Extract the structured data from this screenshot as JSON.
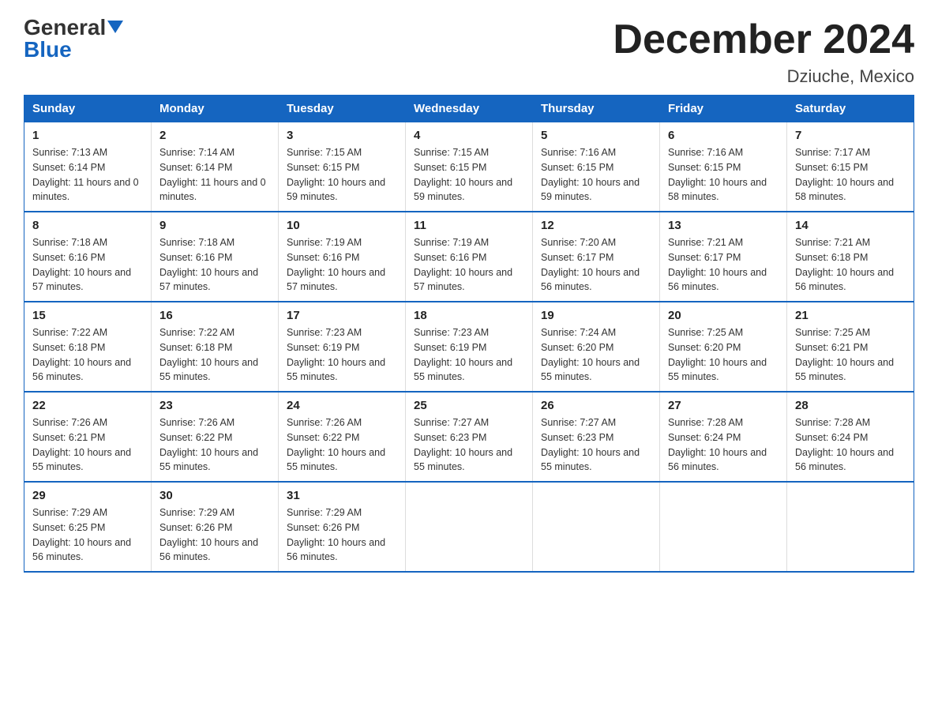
{
  "logo": {
    "line1": "General",
    "arrow": true,
    "line2": "Blue"
  },
  "title": "December 2024",
  "subtitle": "Dziuche, Mexico",
  "days_header": [
    "Sunday",
    "Monday",
    "Tuesday",
    "Wednesday",
    "Thursday",
    "Friday",
    "Saturday"
  ],
  "weeks": [
    [
      {
        "num": "1",
        "sunrise": "7:13 AM",
        "sunset": "6:14 PM",
        "daylight": "11 hours and 0 minutes."
      },
      {
        "num": "2",
        "sunrise": "7:14 AM",
        "sunset": "6:14 PM",
        "daylight": "11 hours and 0 minutes."
      },
      {
        "num": "3",
        "sunrise": "7:15 AM",
        "sunset": "6:15 PM",
        "daylight": "10 hours and 59 minutes."
      },
      {
        "num": "4",
        "sunrise": "7:15 AM",
        "sunset": "6:15 PM",
        "daylight": "10 hours and 59 minutes."
      },
      {
        "num": "5",
        "sunrise": "7:16 AM",
        "sunset": "6:15 PM",
        "daylight": "10 hours and 59 minutes."
      },
      {
        "num": "6",
        "sunrise": "7:16 AM",
        "sunset": "6:15 PM",
        "daylight": "10 hours and 58 minutes."
      },
      {
        "num": "7",
        "sunrise": "7:17 AM",
        "sunset": "6:15 PM",
        "daylight": "10 hours and 58 minutes."
      }
    ],
    [
      {
        "num": "8",
        "sunrise": "7:18 AM",
        "sunset": "6:16 PM",
        "daylight": "10 hours and 57 minutes."
      },
      {
        "num": "9",
        "sunrise": "7:18 AM",
        "sunset": "6:16 PM",
        "daylight": "10 hours and 57 minutes."
      },
      {
        "num": "10",
        "sunrise": "7:19 AM",
        "sunset": "6:16 PM",
        "daylight": "10 hours and 57 minutes."
      },
      {
        "num": "11",
        "sunrise": "7:19 AM",
        "sunset": "6:16 PM",
        "daylight": "10 hours and 57 minutes."
      },
      {
        "num": "12",
        "sunrise": "7:20 AM",
        "sunset": "6:17 PM",
        "daylight": "10 hours and 56 minutes."
      },
      {
        "num": "13",
        "sunrise": "7:21 AM",
        "sunset": "6:17 PM",
        "daylight": "10 hours and 56 minutes."
      },
      {
        "num": "14",
        "sunrise": "7:21 AM",
        "sunset": "6:18 PM",
        "daylight": "10 hours and 56 minutes."
      }
    ],
    [
      {
        "num": "15",
        "sunrise": "7:22 AM",
        "sunset": "6:18 PM",
        "daylight": "10 hours and 56 minutes."
      },
      {
        "num": "16",
        "sunrise": "7:22 AM",
        "sunset": "6:18 PM",
        "daylight": "10 hours and 55 minutes."
      },
      {
        "num": "17",
        "sunrise": "7:23 AM",
        "sunset": "6:19 PM",
        "daylight": "10 hours and 55 minutes."
      },
      {
        "num": "18",
        "sunrise": "7:23 AM",
        "sunset": "6:19 PM",
        "daylight": "10 hours and 55 minutes."
      },
      {
        "num": "19",
        "sunrise": "7:24 AM",
        "sunset": "6:20 PM",
        "daylight": "10 hours and 55 minutes."
      },
      {
        "num": "20",
        "sunrise": "7:25 AM",
        "sunset": "6:20 PM",
        "daylight": "10 hours and 55 minutes."
      },
      {
        "num": "21",
        "sunrise": "7:25 AM",
        "sunset": "6:21 PM",
        "daylight": "10 hours and 55 minutes."
      }
    ],
    [
      {
        "num": "22",
        "sunrise": "7:26 AM",
        "sunset": "6:21 PM",
        "daylight": "10 hours and 55 minutes."
      },
      {
        "num": "23",
        "sunrise": "7:26 AM",
        "sunset": "6:22 PM",
        "daylight": "10 hours and 55 minutes."
      },
      {
        "num": "24",
        "sunrise": "7:26 AM",
        "sunset": "6:22 PM",
        "daylight": "10 hours and 55 minutes."
      },
      {
        "num": "25",
        "sunrise": "7:27 AM",
        "sunset": "6:23 PM",
        "daylight": "10 hours and 55 minutes."
      },
      {
        "num": "26",
        "sunrise": "7:27 AM",
        "sunset": "6:23 PM",
        "daylight": "10 hours and 55 minutes."
      },
      {
        "num": "27",
        "sunrise": "7:28 AM",
        "sunset": "6:24 PM",
        "daylight": "10 hours and 56 minutes."
      },
      {
        "num": "28",
        "sunrise": "7:28 AM",
        "sunset": "6:24 PM",
        "daylight": "10 hours and 56 minutes."
      }
    ],
    [
      {
        "num": "29",
        "sunrise": "7:29 AM",
        "sunset": "6:25 PM",
        "daylight": "10 hours and 56 minutes."
      },
      {
        "num": "30",
        "sunrise": "7:29 AM",
        "sunset": "6:26 PM",
        "daylight": "10 hours and 56 minutes."
      },
      {
        "num": "31",
        "sunrise": "7:29 AM",
        "sunset": "6:26 PM",
        "daylight": "10 hours and 56 minutes."
      },
      null,
      null,
      null,
      null
    ]
  ]
}
